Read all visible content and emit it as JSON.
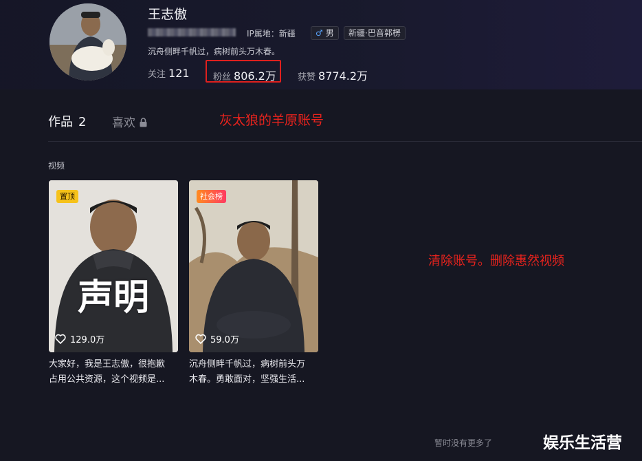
{
  "profile": {
    "name": "王志傲",
    "ip": "IP属地：新疆",
    "gender_label": "男",
    "location_tag": "新疆·巴音郭楞",
    "bio": "沉舟侧畔千帆过，病树前头万木春。",
    "following_label": "关注",
    "following_count": "121",
    "fans_label": "粉丝",
    "fans_count": "806.2万",
    "likes_label": "获赞",
    "likes_count": "8774.2万"
  },
  "tabs": {
    "works_label": "作品",
    "works_count": "2",
    "likes_label": "喜欢"
  },
  "annotations": {
    "note_top": "灰太狼的羊原账号",
    "note_right": "清除账号。删除惠然视频"
  },
  "section_label": "视频",
  "videos": [
    {
      "badge": "置顶",
      "overlay": "声明",
      "likes": "129.0万",
      "caption_line1": "大家好，我是王志傲，很抱歉",
      "caption_line2": "占用公共资源，这个视频是..."
    },
    {
      "badge": "社会榜",
      "overlay": "",
      "likes": "59.0万",
      "caption_line1": "沉舟侧畔千帆过，病树前头万",
      "caption_line2": "木春。勇敢面对，坚强生活..."
    }
  ],
  "footer": {
    "no_more": "暂时没有更多了",
    "watermark": "娱乐生活营"
  },
  "colors": {
    "background": "#161722",
    "annotation_red": "#e8231d",
    "pin_badge": "#f6c21a",
    "hot_badge": "#ff3a62"
  }
}
